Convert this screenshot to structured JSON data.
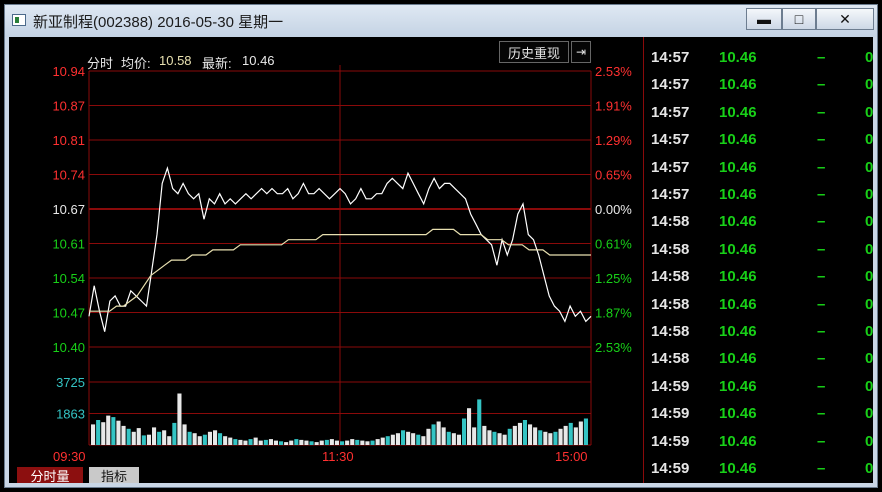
{
  "window": {
    "title": "新亚制程(002388) 2016-05-30 星期一",
    "controls": {
      "minimize": "▬",
      "maximize": "□",
      "close": "✕"
    }
  },
  "chart": {
    "label_mode": "分时",
    "label_avg": "均价:",
    "avg_price": "10.58",
    "label_latest": "最新:",
    "latest_price": "10.46",
    "history_button": "历史重现",
    "arrow_button": "⇥",
    "price_axis": [
      "10.94",
      "10.87",
      "10.81",
      "10.74",
      "10.67",
      "10.61",
      "10.54",
      "10.47",
      "10.40"
    ],
    "pct_axis": [
      "2.53%",
      "1.91%",
      "1.29%",
      "0.65%",
      "0.00%",
      "0.61%",
      "1.25%",
      "1.87%",
      "2.53%"
    ],
    "volume_axis": [
      "3725",
      "1863"
    ],
    "time_axis": [
      "09:30",
      "11:30",
      "15:00"
    ]
  },
  "chart_data": {
    "type": "line",
    "series": [
      {
        "values": [
          10.46,
          10.52,
          10.47,
          10.43,
          10.49,
          10.5,
          10.48,
          10.48,
          10.51,
          10.5,
          10.49,
          10.48,
          10.55,
          10.62,
          10.72,
          10.75,
          10.71,
          10.7,
          10.72,
          10.7,
          10.69,
          10.7,
          10.65,
          10.69,
          10.68,
          10.7,
          10.68,
          10.69,
          10.68,
          10.69,
          10.7,
          10.69,
          10.7,
          10.71,
          10.7,
          10.71,
          10.7,
          10.7,
          10.71,
          10.69,
          10.7,
          10.72,
          10.7,
          10.7,
          10.71,
          10.7,
          10.69,
          10.7,
          10.71,
          10.7,
          10.68,
          10.69,
          10.71,
          10.69,
          10.69,
          10.7,
          10.7,
          10.72,
          10.73,
          10.72,
          10.71,
          10.74,
          10.72,
          10.7,
          10.68,
          10.71,
          10.73,
          10.71,
          10.72,
          10.72,
          10.71,
          10.7,
          10.69,
          10.66,
          10.64,
          10.62,
          10.61,
          10.6,
          10.56,
          10.61,
          10.58,
          10.61,
          10.66,
          10.68,
          10.62,
          10.61,
          10.58,
          10.54,
          10.5,
          10.48,
          10.47,
          10.45,
          10.48,
          10.46,
          10.47,
          10.45,
          10.46
        ]
      },
      {
        "values": [
          10.47,
          10.47,
          10.47,
          10.47,
          10.48,
          10.48,
          10.49,
          10.5,
          10.52,
          10.54,
          10.55,
          10.56,
          10.57,
          10.57,
          10.57,
          10.58,
          10.58,
          10.58,
          10.59,
          10.59,
          10.59,
          10.59,
          10.6,
          10.6,
          10.6,
          10.6,
          10.6,
          10.6,
          10.6,
          10.61,
          10.61,
          10.61,
          10.61,
          10.61,
          10.62,
          10.62,
          10.62,
          10.62,
          10.62,
          10.62,
          10.62,
          10.62,
          10.62,
          10.62,
          10.62,
          10.62,
          10.62,
          10.62,
          10.62,
          10.62,
          10.63,
          10.63,
          10.63,
          10.63,
          10.62,
          10.62,
          10.62,
          10.62,
          10.61,
          10.61,
          10.61,
          10.6,
          10.6,
          10.6,
          10.59,
          10.59,
          10.59,
          10.58,
          10.58,
          10.58,
          10.58,
          10.58,
          10.58,
          10.58
        ]
      }
    ],
    "volume": [
      1400,
      1700,
      1550,
      2000,
      1900,
      1650,
      1300,
      1100,
      900,
      1150,
      650,
      700,
      1200,
      900,
      1000,
      600,
      1500,
      3500,
      1400,
      900,
      800,
      600,
      700,
      900,
      1000,
      800,
      600,
      500,
      400,
      350,
      300,
      400,
      500,
      300,
      350,
      400,
      300,
      250,
      200,
      300,
      400,
      350,
      300,
      250,
      200,
      300,
      350,
      400,
      300,
      250,
      300,
      400,
      350,
      300,
      250,
      300,
      400,
      500,
      600,
      700,
      800,
      1000,
      900,
      800,
      700,
      600,
      1100,
      1400,
      1600,
      1200,
      900,
      800,
      700,
      1800,
      2500,
      1200,
      3100,
      1300,
      1000,
      900,
      800,
      700,
      1100,
      1300,
      1500,
      1700,
      1400,
      1200,
      1000,
      900,
      800,
      900,
      1100,
      1300,
      1500,
      1200,
      1600,
      1800
    ],
    "ylim": [
      10.4,
      10.94
    ],
    "prev_close": 10.67
  },
  "ticks": [
    {
      "time": "14:57",
      "price": "10.46",
      "dir": "–",
      "vol": "0"
    },
    {
      "time": "14:57",
      "price": "10.46",
      "dir": "–",
      "vol": "0"
    },
    {
      "time": "14:57",
      "price": "10.46",
      "dir": "–",
      "vol": "0"
    },
    {
      "time": "14:57",
      "price": "10.46",
      "dir": "–",
      "vol": "0"
    },
    {
      "time": "14:57",
      "price": "10.46",
      "dir": "–",
      "vol": "0"
    },
    {
      "time": "14:57",
      "price": "10.46",
      "dir": "–",
      "vol": "0"
    },
    {
      "time": "14:58",
      "price": "10.46",
      "dir": "–",
      "vol": "0"
    },
    {
      "time": "14:58",
      "price": "10.46",
      "dir": "–",
      "vol": "0"
    },
    {
      "time": "14:58",
      "price": "10.46",
      "dir": "–",
      "vol": "0"
    },
    {
      "time": "14:58",
      "price": "10.46",
      "dir": "–",
      "vol": "0"
    },
    {
      "time": "14:58",
      "price": "10.46",
      "dir": "–",
      "vol": "0"
    },
    {
      "time": "14:58",
      "price": "10.46",
      "dir": "–",
      "vol": "0"
    },
    {
      "time": "14:59",
      "price": "10.46",
      "dir": "–",
      "vol": "0"
    },
    {
      "time": "14:59",
      "price": "10.46",
      "dir": "–",
      "vol": "0"
    },
    {
      "time": "14:59",
      "price": "10.46",
      "dir": "–",
      "vol": "0"
    },
    {
      "time": "14:59",
      "price": "10.46",
      "dir": "–",
      "vol": "0"
    }
  ],
  "tabs": {
    "active": "分时量",
    "inactive": "指标"
  },
  "colors": {
    "grid": "#8a0a0a",
    "up": "#ff3030",
    "down": "#18d018",
    "price_line": "#ffffff",
    "avg_line": "#e8e0b0",
    "volume_up": "#e8e8e8",
    "volume_alt": "#34c4c4"
  }
}
